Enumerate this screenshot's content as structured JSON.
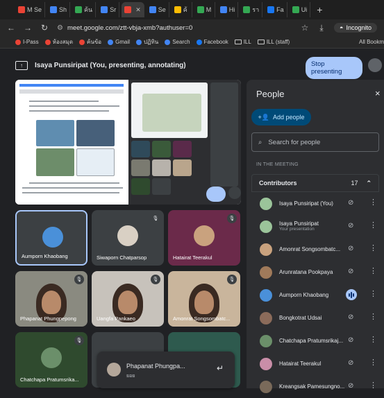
{
  "browser": {
    "tabs": [
      {
        "label": "M Se",
        "color": "#ea4335"
      },
      {
        "label": "Sh",
        "color": "#4285f4"
      },
      {
        "label": "ค้น",
        "color": "#34a853"
      },
      {
        "label": "Sr",
        "color": "#4285f4"
      },
      {
        "label": "",
        "color": "#ea4335",
        "active": true
      },
      {
        "label": "Se",
        "color": "#4285f4"
      },
      {
        "label": "ค้",
        "color": "#fbbc04"
      },
      {
        "label": "M",
        "color": "#34a853"
      },
      {
        "label": "Hi",
        "color": "#4285f4"
      },
      {
        "label": "รา",
        "color": "#34a853"
      },
      {
        "label": "Fa",
        "color": "#1877f2"
      },
      {
        "label": "Ui",
        "color": "#34a853"
      }
    ],
    "new_tab": "+",
    "url": "meet.google.com/ztt-vbja-xmb?authuser=0",
    "incognito_label": "Incognito",
    "bookmarks": [
      "I-Pass",
      "ห้องสมุด",
      "ค้นข้อ",
      "Gmail",
      "ปฏิทิน",
      "Search",
      "Facebook",
      "ILL",
      "ILL (staff)"
    ],
    "all_bookmarks": "All Bookm"
  },
  "meet": {
    "presenting_text": "Isaya Punsiripat (You, presenting, annotating)",
    "stop_presenting": "Stop presenting",
    "tiles": [
      {
        "name": "Aumporn Khaobang",
        "bg": "#3c4043",
        "avatar": "#4a90d9",
        "highlight": true
      },
      {
        "name": "Siwaporn Chatparsop",
        "bg": "#3c4043",
        "avatar": "#d9d0c4",
        "muted": true
      },
      {
        "name": "Hatairat Teerakul",
        "bg": "#6b2a4a",
        "avatar": "#c9a27e",
        "muted": true
      },
      {
        "name": "Phapanat Phungpepong",
        "bg": "#8a8a80",
        "muted": true
      },
      {
        "name": "Uangfa Pankaeo",
        "bg": "#c7c2bb",
        "muted": true
      },
      {
        "name": "Amonrat Songsombatc...",
        "bg": "#c9b59c",
        "muted": true
      },
      {
        "name": "Chatchapa Pratumsrika...",
        "bg": "#2f4a2e",
        "avatar": "#6b8f6a",
        "muted": true
      },
      {
        "name": "",
        "bg": "#3c4043"
      },
      {
        "name": "",
        "bg": "#2e5a4e"
      }
    ],
    "popup": {
      "name": "Phapanat Phungpa...",
      "sub": "ยอย",
      "action_icon": "↵"
    }
  },
  "people_panel": {
    "title": "People",
    "close": "×",
    "add_people": "Add people",
    "search_placeholder": "Search for people",
    "section": "IN THE MEETING",
    "contributors_label": "Contributors",
    "contributors_count": "17",
    "people": [
      {
        "name": "Isaya Punsiripat (You)",
        "sub": "",
        "avatar": "#9bc49a",
        "speaking": false
      },
      {
        "name": "Isaya Punsiripat",
        "sub": "Your presentation",
        "avatar": "#9bc49a",
        "speaking": false
      },
      {
        "name": "Amonrat Songsombatc...",
        "sub": "",
        "avatar": "#c9a27e",
        "speaking": false
      },
      {
        "name": "Arunratana Pookpaya",
        "sub": "",
        "avatar": "#a07a5a",
        "speaking": false
      },
      {
        "name": "Aumporn Khaobang",
        "sub": "",
        "avatar": "#4a90d9",
        "speaking": true
      },
      {
        "name": "Bongkotrat Udsai",
        "sub": "",
        "avatar": "#8b6b5a",
        "speaking": false
      },
      {
        "name": "Chatchapa Pratumsrikaj...",
        "sub": "",
        "avatar": "#6b8f6a",
        "speaking": false
      },
      {
        "name": "Hatairat Teerakul",
        "sub": "",
        "avatar": "#c98ea8",
        "speaking": false
      },
      {
        "name": "Kreangsak Pamesungno...",
        "sub": "",
        "avatar": "#7a6a5a",
        "speaking": false
      }
    ]
  }
}
